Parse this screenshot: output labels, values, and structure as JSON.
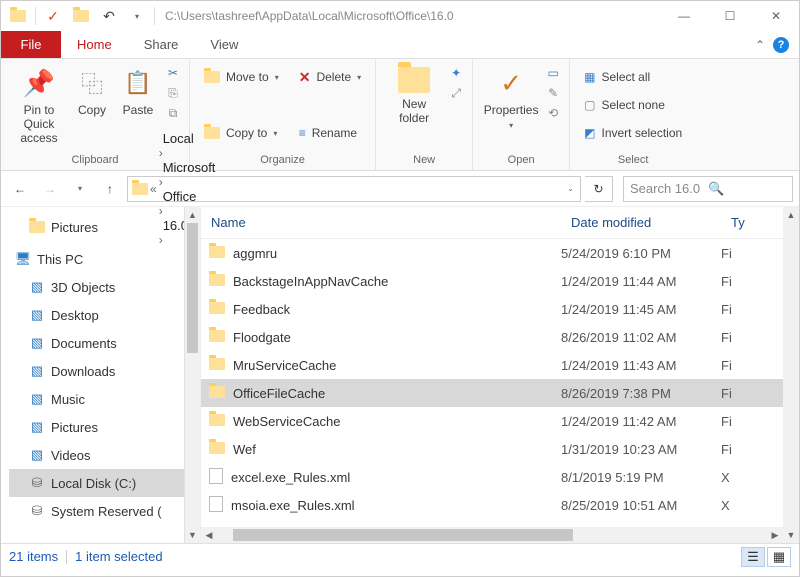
{
  "title_path": "C:\\Users\\tashreef\\AppData\\Local\\Microsoft\\Office\\16.0",
  "tabs": {
    "file": "File",
    "home": "Home",
    "share": "Share",
    "view": "View"
  },
  "ribbon": {
    "clipboard": {
      "label": "Clipboard",
      "pin": "Pin to Quick access",
      "copy": "Copy",
      "paste": "Paste"
    },
    "organize": {
      "label": "Organize",
      "moveto": "Move to",
      "copyto": "Copy to",
      "delete": "Delete",
      "rename": "Rename"
    },
    "new": {
      "label": "New",
      "newfolder": "New folder"
    },
    "open": {
      "label": "Open",
      "properties": "Properties"
    },
    "select": {
      "label": "Select",
      "all": "Select all",
      "none": "Select none",
      "invert": "Invert selection"
    }
  },
  "breadcrumbs": [
    "Local",
    "Microsoft",
    "Office",
    "16.0"
  ],
  "search_placeholder": "Search 16.0",
  "columns": {
    "name": "Name",
    "date": "Date modified",
    "type": "Ty"
  },
  "nav": {
    "pictures": "Pictures",
    "thispc": "This PC",
    "items": [
      "3D Objects",
      "Desktop",
      "Documents",
      "Downloads",
      "Music",
      "Pictures",
      "Videos",
      "Local Disk (C:)",
      "System Reserved ("
    ]
  },
  "rows": [
    {
      "icon": "folder",
      "name": "aggmru",
      "date": "5/24/2019 6:10 PM",
      "type": "Fi"
    },
    {
      "icon": "folder",
      "name": "BackstageInAppNavCache",
      "date": "1/24/2019 11:44 AM",
      "type": "Fi"
    },
    {
      "icon": "folder",
      "name": "Feedback",
      "date": "1/24/2019 11:45 AM",
      "type": "Fi"
    },
    {
      "icon": "folder",
      "name": "Floodgate",
      "date": "8/26/2019 11:02 AM",
      "type": "Fi"
    },
    {
      "icon": "folder",
      "name": "MruServiceCache",
      "date": "1/24/2019 11:43 AM",
      "type": "Fi"
    },
    {
      "icon": "folder",
      "name": "OfficeFileCache",
      "date": "8/26/2019 7:38 PM",
      "type": "Fi",
      "selected": true
    },
    {
      "icon": "folder",
      "name": "WebServiceCache",
      "date": "1/24/2019 11:42 AM",
      "type": "Fi"
    },
    {
      "icon": "folder",
      "name": "Wef",
      "date": "1/31/2019 10:23 AM",
      "type": "Fi"
    },
    {
      "icon": "file",
      "name": "excel.exe_Rules.xml",
      "date": "8/1/2019 5:19 PM",
      "type": "X"
    },
    {
      "icon": "file",
      "name": "msoia.exe_Rules.xml",
      "date": "8/25/2019 10:51 AM",
      "type": "X"
    }
  ],
  "status": {
    "count": "21 items",
    "sel": "1 item selected"
  }
}
